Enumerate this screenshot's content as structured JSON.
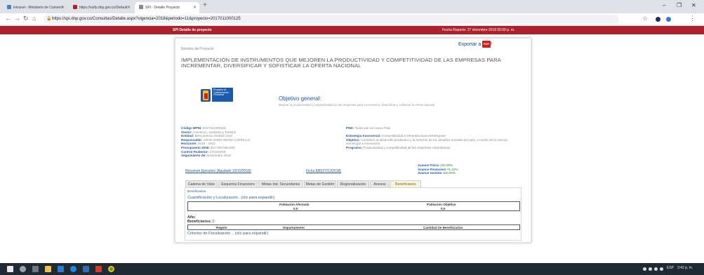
{
  "browser": {
    "tabs": [
      {
        "title": "Intranet - Ministerio de Comerci",
        "favicon_color": "#4a7fc0"
      },
      {
        "title": "https://suifp.dnp.gov.co/Default",
        "favicon_color": "#b0202b"
      },
      {
        "title": "SPI - Detalle Proyecto",
        "favicon_color": "#888888"
      }
    ],
    "url": "https://spi.dnp.gov.co/Consultas/Detalle.aspx?vigencia=2018&periodo=11&proyecto=2017011000125"
  },
  "header": {
    "title": "SPI Detalle de proyecto",
    "report_date": "Fecha Reporte: 27 diciembre 2018 00:00 p. m."
  },
  "project": {
    "name_label": "Nombre del Proyecto",
    "export_label": "Exportar a PDF",
    "pdf_badge": "PDF",
    "title": "IMPLEMENTACIÓN DE INSTRUMENTOS QUE MEJOREN LA PRODUCTIVIDAD Y COMPETITIVIDAD DE LAS EMPRESAS PARA INCREMENTAR, DIVERSIFICAR Y SOFISTICAR LA OFERTA NACIONAL",
    "logo_text": "Programa de Transformación Productiva",
    "objective_heading": "Objetivo general:",
    "objective_text": "Mejorar la productividad y competitividad de las empresas para incrementar, diversificar y sofisticar la oferta nacional"
  },
  "meta_left": [
    {
      "label": "Código BPIN",
      "value": "2017011000125"
    },
    {
      "label": "Sector",
      "value": "Comercio, Industria y Turismo"
    },
    {
      "label": "Entidad",
      "value": "Mincomercio Gestión Gral"
    },
    {
      "label": "Responsable",
      "value": "JOHN JAIRO REINA CARRILLO"
    },
    {
      "label": "Horizonte",
      "value": "2018 - 2022"
    },
    {
      "label": "Presupuesto 2018",
      "value": "$17.000.000.000"
    },
    {
      "label": "Control Posterior",
      "value": "27/12/2018"
    },
    {
      "label": "Seguimiento de",
      "value": "Noviembre 2018"
    }
  ],
  "meta_right": [
    {
      "label": "PND",
      "value": "Todos por un nuevo País"
    },
    {
      "label": "",
      "value": ""
    },
    {
      "label": "Estrategia transversal",
      "value": "Competitividad e infraestructura estratégicas"
    },
    {
      "label": "Objetivo",
      "value": "Contribuir al desarrollo productivo y la solución de los desafíos sociales del país, a través de la ciencia, tecnología e innovación"
    },
    {
      "label": "Programa",
      "value": "Productividad y competitividad de las empresas colombianas"
    }
  ],
  "avance": [
    {
      "label": "Avance Físico",
      "value": "102,00%"
    },
    {
      "label": "Avance Financiero",
      "value": "71,10%"
    },
    {
      "label": "Avance Gestión",
      "value": "100,00%"
    }
  ],
  "links": {
    "resumen": "Resumen Ejecutivo (Ajustado 10/10/2018)",
    "ficha": "Ficha EBI(27/12/2018)"
  },
  "page_tabs": [
    {
      "label": "Cadena de Valor"
    },
    {
      "label": "Esquema Financiero"
    },
    {
      "label": "Metas Ind. Secundarios"
    },
    {
      "label": "Metas de Gestión"
    },
    {
      "label": "Regionalización"
    },
    {
      "label": "Anexos"
    },
    {
      "label": "Beneficiarios"
    }
  ],
  "beneficiarios": {
    "breadcrumb": "Beneficiarios",
    "cuantificacion": "Cuantificación y Localización ..(clic para expandir)",
    "col_afectada": "Población Afectada",
    "col_objetivo": "Población Objetivo",
    "val_afectada": "0,0",
    "val_objetivo": "0,0",
    "anio_label": "Año:",
    "beneficiarios_label": "Beneficiarios:",
    "beneficiarios_value": "0",
    "col_region": "Región",
    "col_departamento": "Departamento",
    "col_cantidad": "Cantidad de Beneficiarios",
    "criterios": "Criterios de Focalización .. (clic para expandir)"
  },
  "taskbar": {
    "time": "3:42 p. m.",
    "lang": "ESP"
  }
}
